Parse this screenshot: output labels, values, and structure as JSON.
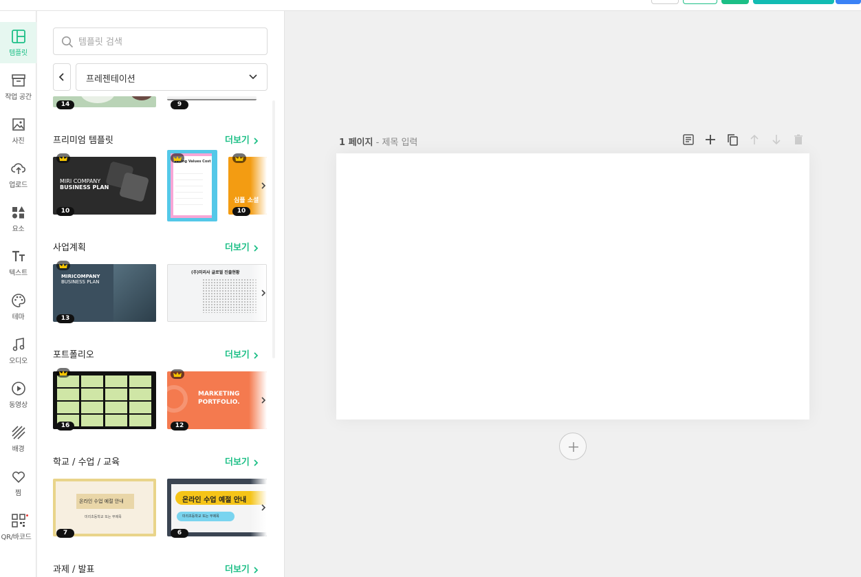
{
  "colors": {
    "accent": "#1cbf86",
    "teal": "#13bcb3",
    "blue": "#3b82f6"
  },
  "sidebar": {
    "items": [
      {
        "label": "템플릿",
        "icon": "template-icon"
      },
      {
        "label": "작업 공간",
        "icon": "archive-icon"
      },
      {
        "label": "사진",
        "icon": "image-icon"
      },
      {
        "label": "업로드",
        "icon": "upload-cloud-icon"
      },
      {
        "label": "요소",
        "icon": "shapes-icon"
      },
      {
        "label": "텍스트",
        "icon": "text-icon"
      },
      {
        "label": "테마",
        "icon": "palette-icon"
      },
      {
        "label": "오디오",
        "icon": "music-icon"
      },
      {
        "label": "동영상",
        "icon": "play-circle-icon"
      },
      {
        "label": "배경",
        "icon": "background-pattern-icon"
      },
      {
        "label": "찜",
        "icon": "heart-icon"
      },
      {
        "label": "QR/바코드",
        "icon": "qr-code-icon"
      }
    ]
  },
  "panel": {
    "search_placeholder": "템플릿 검색",
    "category_value": "프레젠테이션",
    "more_label": "더보기",
    "top_counts": [
      "14",
      "9"
    ],
    "sections": [
      {
        "title": "프리미엄 템플릿",
        "counts": [
          "10",
          "10"
        ],
        "thumb_texts": [
          "MIRI COMPANY",
          "BUSINESS PLAN",
          "Saving Values Cost",
          "심플 소셜"
        ]
      },
      {
        "title": "사업계획",
        "counts": [
          "13"
        ],
        "thumb_texts": [
          "MIRICOMPANY",
          "BUSINESS PLAN",
          "(주)미리사 글로벌 진출현황"
        ]
      },
      {
        "title": "포트폴리오",
        "counts": [
          "16",
          "12"
        ],
        "thumb_texts": [
          "MARKETING",
          "PORTFOLIO."
        ]
      },
      {
        "title": "학교 / 수업 / 교육",
        "counts": [
          "7",
          "6"
        ],
        "thumb_texts": [
          "온라인 수업 예절 안내",
          "미리초등학교 또는 부제목",
          "온라인 수업 예절 안내",
          "미리초등학교 또는 부제목"
        ]
      },
      {
        "title": "과제 / 발표",
        "counts": []
      }
    ]
  },
  "editor": {
    "page_number": "1 페이지",
    "separator": " - ",
    "page_title_placeholder": "제목 입력",
    "tools": [
      "memo-icon",
      "add-icon",
      "duplicate-icon",
      "move-up-icon",
      "move-down-icon",
      "delete-icon"
    ]
  }
}
